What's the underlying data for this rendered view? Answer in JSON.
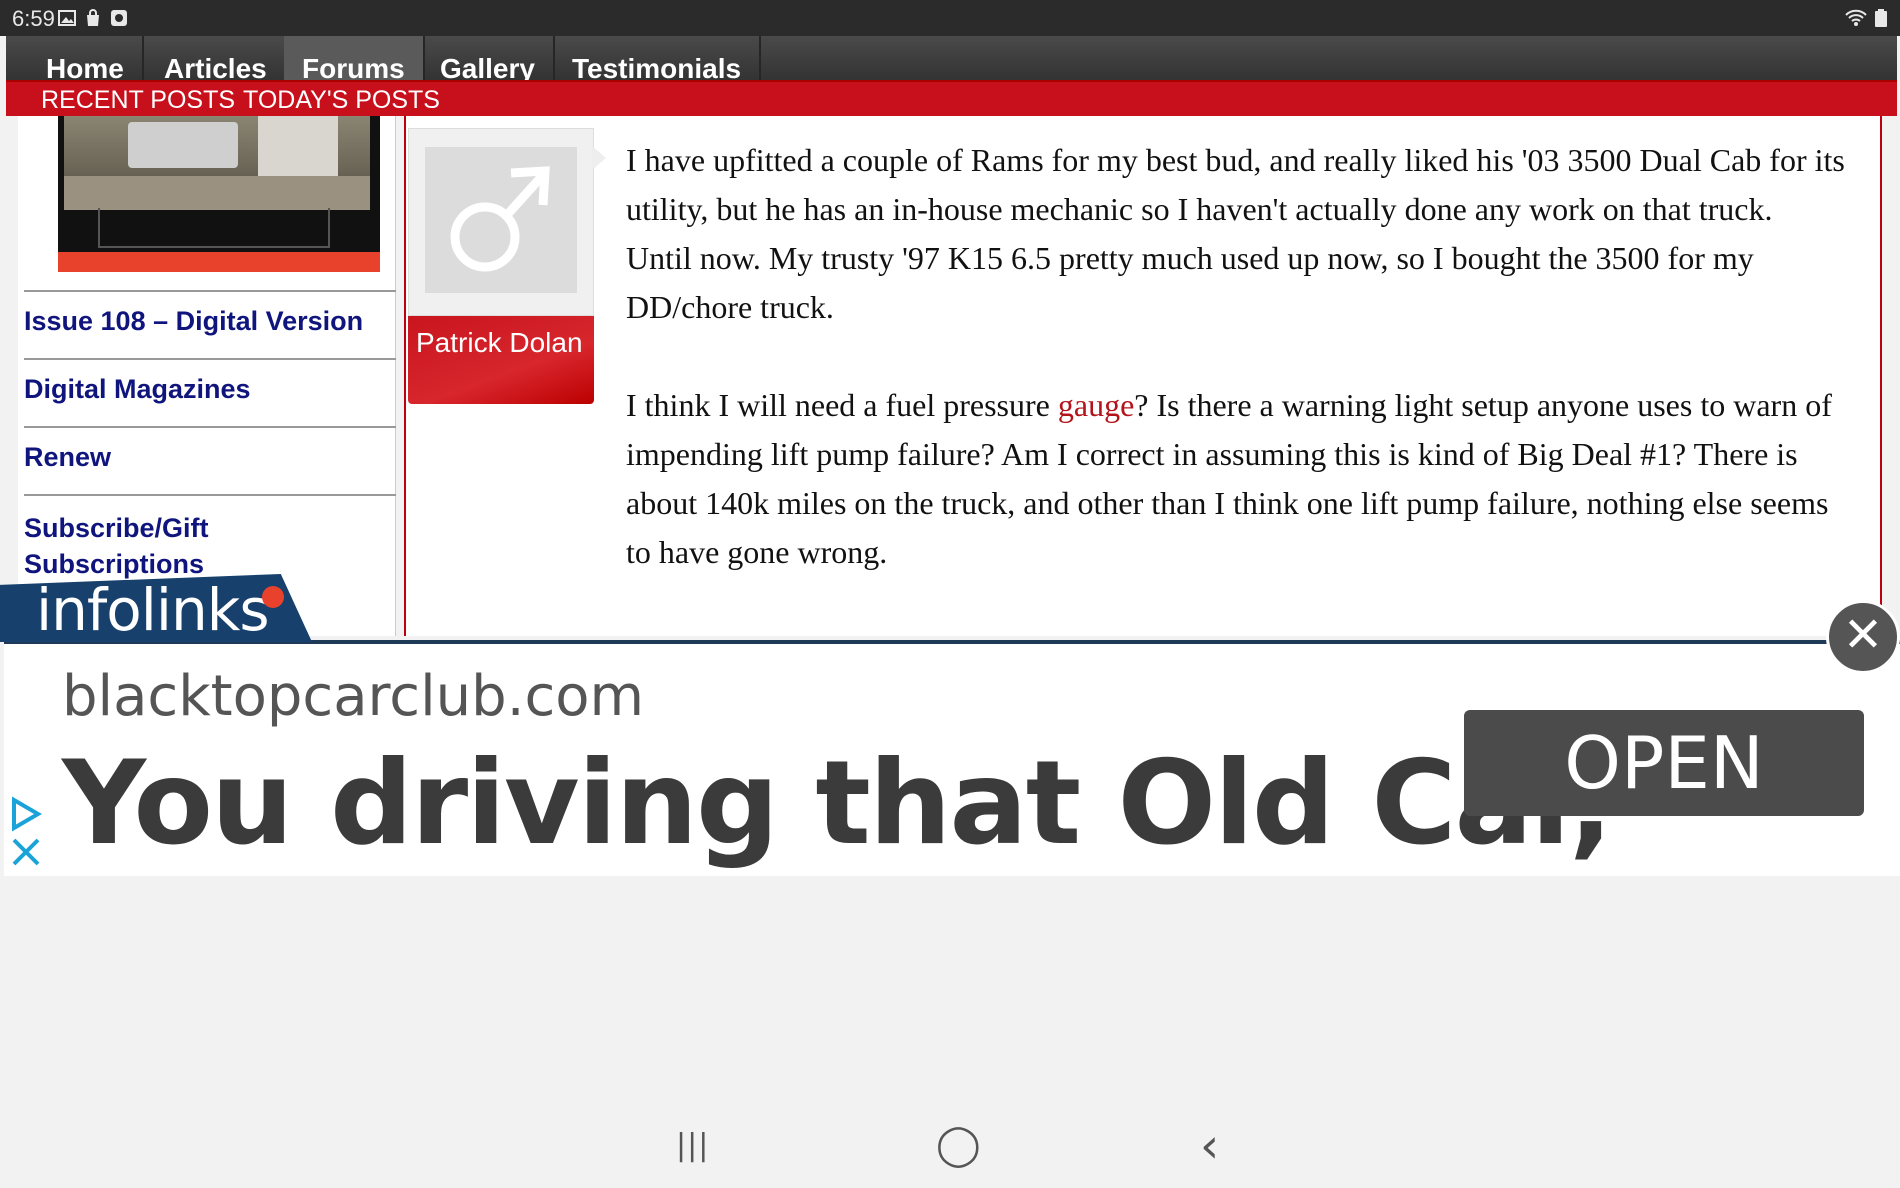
{
  "status_bar": {
    "time": "6:59",
    "icons": [
      "gallery-icon",
      "bag-icon",
      "settings-icon",
      "wifi-icon",
      "battery-icon"
    ]
  },
  "nav": {
    "items": [
      "Home",
      "Articles",
      "Forums",
      "Gallery",
      "Testimonials"
    ],
    "active": "Forums"
  },
  "subnav": {
    "items": [
      "RECENT POSTS",
      "TODAY'S POSTS"
    ]
  },
  "sidebar": {
    "links": [
      "Issue 108 – Digital Version",
      "Digital Magazines",
      "Renew",
      "Subscribe/Gift Subscriptions"
    ]
  },
  "post": {
    "author": "Patrick Dolan",
    "p1": "I have upfitted a couple of Rams for my best bud, and really liked his '03 3500 Dual Cab for its utility, but he has an in-house mechanic so I haven't actually done any work on that truck. Until now. My trusty '97 K15 6.5 pretty much used up now, so I bought the 3500 for my DD/chore truck.",
    "p2_before": "I think I will need a fuel pressure ",
    "p2_keyword": "gauge",
    "p2_after": "? Is there a warning light setup anyone uses to warn of impending lift pump failure? Am I correct in assuming this is kind of Big Deal #1? There is about 140k miles on the truck, and other than I think one lift pump failure, nothing else seems to have gone wrong."
  },
  "ad": {
    "brand": "infolinks",
    "domain": "blacktopcarclub.com",
    "headline": "You driving that Old Car,",
    "cta": "OPEN",
    "close_glyph": "✕"
  },
  "bottom_nav": {
    "recents": "|||",
    "home": "◯",
    "back": "‹"
  },
  "colors": {
    "brand_red": "#c8101c",
    "link_blue": "#10157e",
    "ad_navy": "#17406d"
  }
}
